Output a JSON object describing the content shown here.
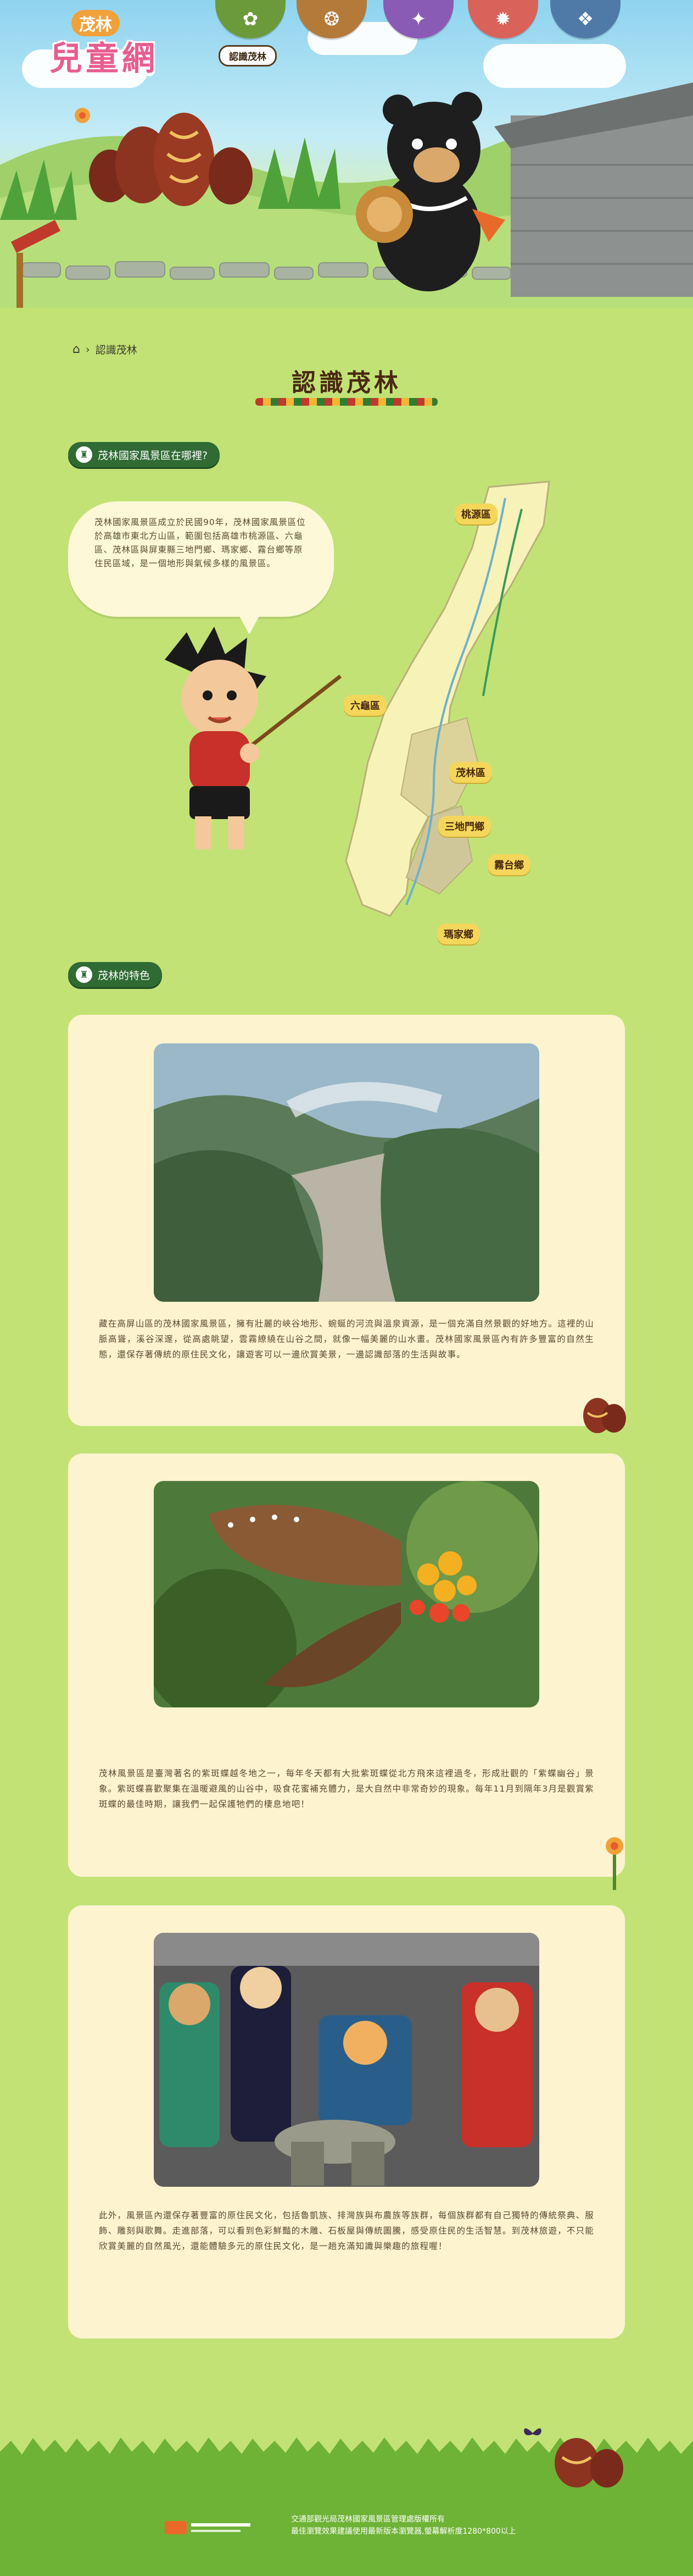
{
  "site": {
    "logo_top": "茂林",
    "logo_main": "兒童網"
  },
  "nav": {
    "label": "認識茂林",
    "items": [
      {
        "name": "nav-item-1",
        "color": "#6a9a3a",
        "glyph": "✿"
      },
      {
        "name": "nav-item-2",
        "color": "#b47a3a",
        "glyph": "❂"
      },
      {
        "name": "nav-item-3",
        "color": "#8a5bb5",
        "glyph": "✦"
      },
      {
        "name": "nav-item-4",
        "color": "#d9625a",
        "glyph": "✹"
      },
      {
        "name": "nav-item-5",
        "color": "#4f7aa8",
        "glyph": "❖"
      }
    ]
  },
  "breadcrumb": {
    "current": "認識茂林"
  },
  "page": {
    "title": "認識茂林"
  },
  "sections": {
    "location": {
      "title": "茂林國家風景區在哪裡?",
      "bubble_text": "茂林國家風景區成立於民國90年，茂林國家風景區位於高雄市東北方山區，範圍包括高雄市桃源區、六龜區、茂林區與屏東縣三地門鄉、瑪家鄉、霧台鄉等原住民區域，是一個地形與氣候多樣的風景區。",
      "map_labels": {
        "taoyuan": "桃源區",
        "liugui": "六龜區",
        "maolin": "茂林區",
        "sandimen": "三地門鄉",
        "wutai": "霧台鄉",
        "majia": "瑪家鄉"
      }
    },
    "features": {
      "title": "茂林的特色"
    }
  },
  "cards": [
    {
      "text": "藏在高屏山區的茂林國家風景區，擁有壯麗的峽谷地形、蜿蜒的河流與溫泉資源，是一個充滿自然景觀的好地方。這裡的山脈高聳，溪谷深邃，從高處眺望，雲霧繚繞在山谷之間，就像一幅美麗的山水畫。茂林國家風景區內有許多豐富的自然生態，還保存著傳統的原住民文化，讓遊客可以一邊欣賞美景，一邊認識部落的生活與故事。"
    },
    {
      "text": "茂林風景區是臺灣著名的紫斑蝶越冬地之一，每年冬天都有大批紫斑蝶從北方飛來這裡過冬，形成壯觀的「紫蝶幽谷」景象。紫斑蝶喜歡聚集在溫暖避風的山谷中，吸食花蜜補充體力，是大自然中非常奇妙的現象。每年11月到隔年3月是觀賞紫斑蝶的最佳時期，讓我們一起保護牠們的棲息地吧！"
    },
    {
      "text": "此外，風景區內還保存著豐富的原住民文化，包括魯凱族、排灣族與布農族等族群，每個族群都有自己獨特的傳統祭典、服飾、雕刻與歌舞。走進部落，可以看到色彩鮮豔的木雕、石板屋與傳統圖騰，感受原住民的生活智慧。到茂林旅遊，不只能欣賞美麗的自然風光，還能體驗多元的原住民文化，是一趟充滿知識與樂趣的旅程喔！"
    }
  ],
  "footer": {
    "line1": "交通部觀光局茂林國家風景區管理處版權所有",
    "line2": "最佳瀏覽效果建議使用最新版本瀏覽器,螢幕解析度1280*800以上"
  },
  "colors": {
    "page_bg": "#c2e276",
    "card_bg": "#fdf3cf",
    "pill_bg": "#2f6b33",
    "tag_bg": "#f4d65a"
  }
}
